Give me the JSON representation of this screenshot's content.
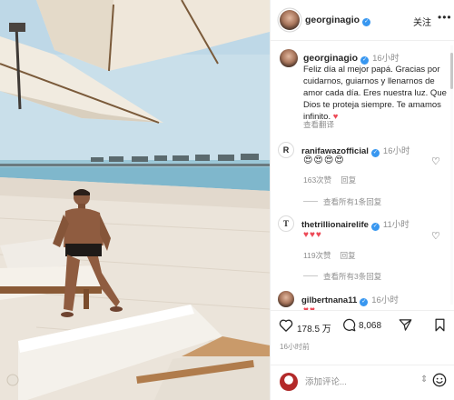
{
  "post": {
    "username": "georginagio",
    "follow_label": "关注",
    "more_icon": "more-icon",
    "caption": {
      "username": "georginagio",
      "time": "16小时",
      "text": "Feliz día al mejor papá. Gracias por cuidarnos, guiarnos y llenarnos de amor cada día. Eres nuestra luz. Que Dios te proteja siempre. Te amamos infinito.",
      "heart": "♥",
      "translate_label": "查看翻译"
    },
    "comments": [
      {
        "username": "ranifawazofficial",
        "avatar_letter": "R",
        "time": "16小时",
        "text": "😍😍😍😍",
        "likes": "163次赞",
        "reply_label": "回复",
        "view_replies": "查看所有1条回复"
      },
      {
        "username": "thetrillionairelife",
        "avatar_letter": "T",
        "time": "11小时",
        "text": "♥♥♥",
        "likes": "119次赞",
        "reply_label": "回复",
        "view_replies": "查看所有3条回复"
      },
      {
        "username": "gilbertnana11",
        "time": "16小时",
        "text": "♥♥"
      }
    ]
  },
  "actions": {
    "like_count": "178.5 万",
    "comment_count": "8,068",
    "post_time": "16小时前"
  },
  "composer": {
    "placeholder": "添加评论...",
    "sort_symbol": "⇕"
  },
  "colors": {
    "verified": "#3897f0",
    "heart_red": "#ed4956",
    "muted_text": "#8e8e8e"
  }
}
